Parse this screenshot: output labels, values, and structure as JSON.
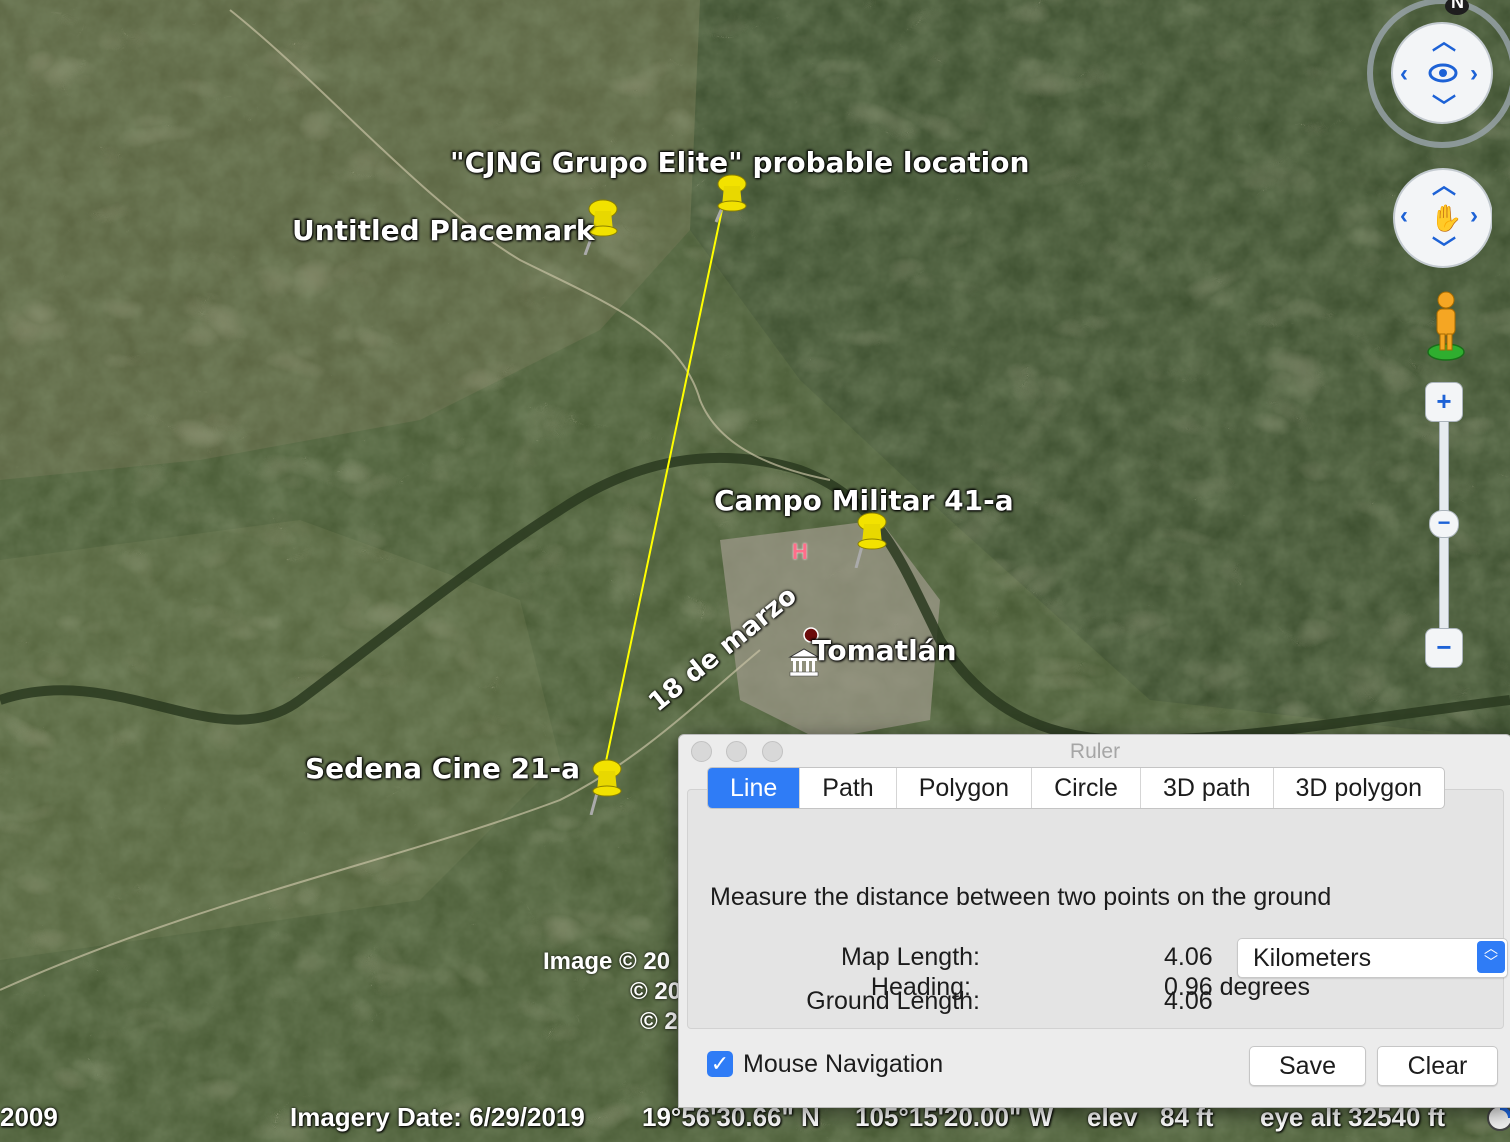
{
  "placemarks": [
    {
      "label": "\"CJNG Grupo Elite\" probable location"
    },
    {
      "label": "Untitled Placemark"
    },
    {
      "label": "Campo Militar 41-a"
    },
    {
      "label": "Sedena Cine 21-a"
    }
  ],
  "town_label": "Tomatlán",
  "road_label": "18 de marzo",
  "hospital_marker": "H",
  "copyright": [
    "Image © 20",
    "© 20",
    "© 2"
  ],
  "statusbar": {
    "year": "2009",
    "imagery_date": "Imagery Date: 6/29/2019",
    "lat": "19°56'30.66\" N",
    "lon": "105°15'20.00\" W",
    "elev_label": "elev",
    "elev_value": "84 ft",
    "eye_alt": "eye alt  32540 ft"
  },
  "compass_north": "N",
  "ruler": {
    "title": "Ruler",
    "tabs": [
      "Line",
      "Path",
      "Polygon",
      "Circle",
      "3D path",
      "3D polygon"
    ],
    "active_tab": "Line",
    "description": "Measure the distance between two points on the ground",
    "map_length_label": "Map Length:",
    "map_length_value": "4.06",
    "unit": "Kilometers",
    "ground_length_label": "Ground Length:",
    "ground_length_value": "4.06",
    "heading_label": "Heading:",
    "heading_value": "0.96 degrees",
    "mouse_nav_label": "Mouse Navigation",
    "mouse_nav_checked": true,
    "save_label": "Save",
    "clear_label": "Clear"
  },
  "colors": {
    "measure_line": "#ffff00",
    "pin": "#f2e200",
    "accent": "#2f7cf6"
  }
}
